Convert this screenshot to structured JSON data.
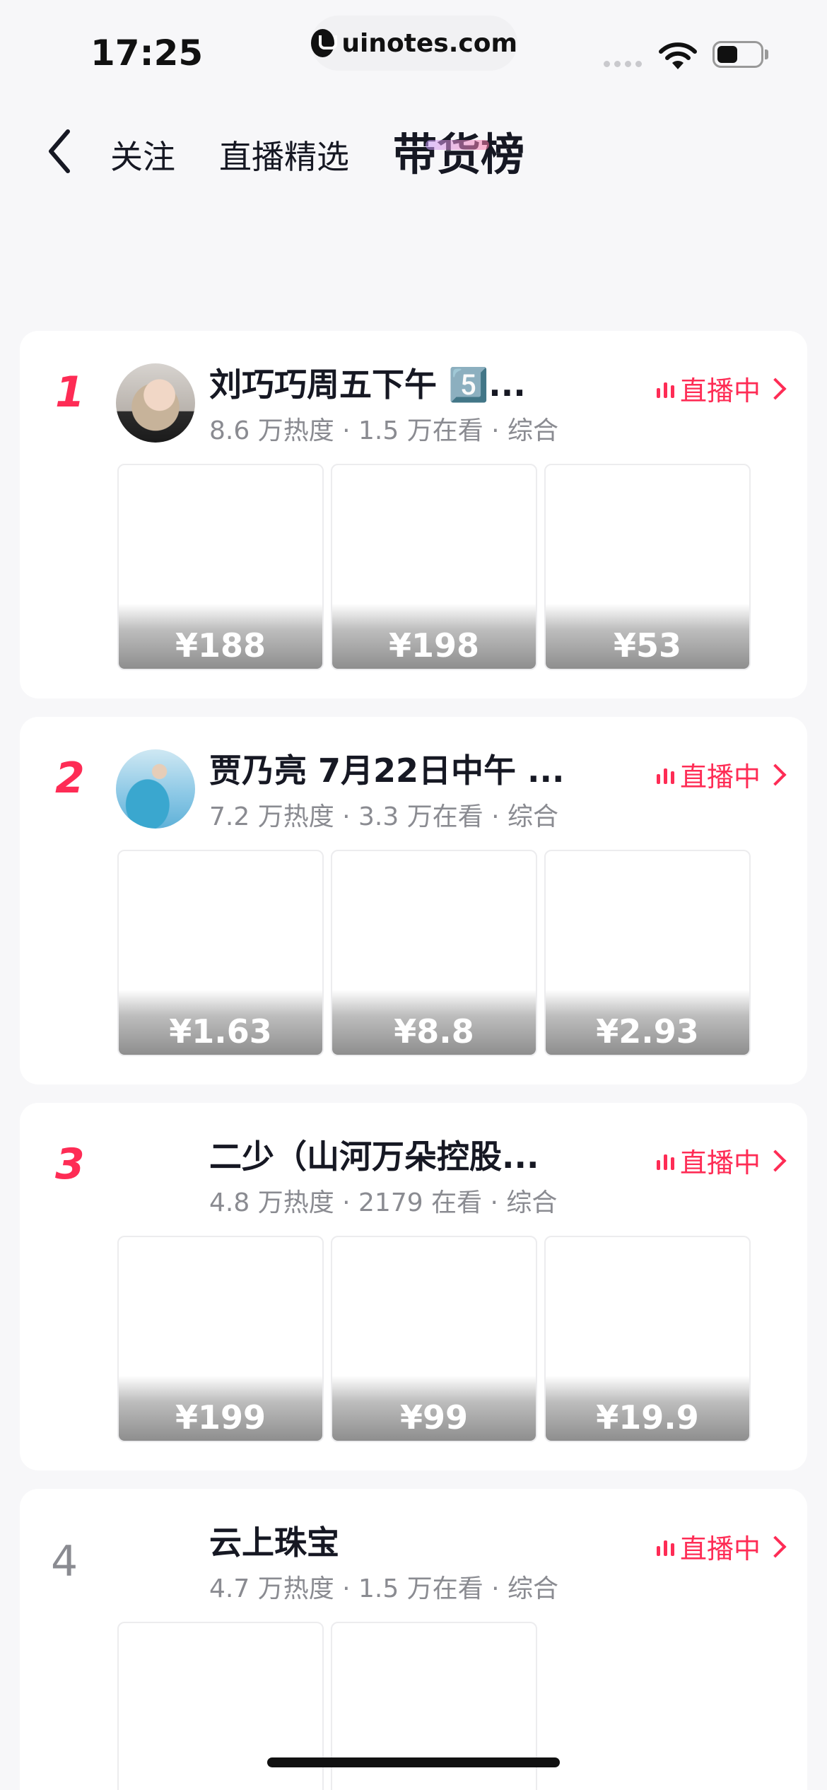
{
  "status_bar": {
    "time": "17:25",
    "url": "uinotes.com"
  },
  "nav": {
    "back_icon": "chevron-left-icon",
    "tabs": [
      {
        "label": "关注",
        "active": false
      },
      {
        "label": "直播精选",
        "active": false
      },
      {
        "label": "带货榜",
        "active": true
      }
    ]
  },
  "colors": {
    "accent": "#fe2c55",
    "text_primary": "#161823",
    "text_secondary": "#8a8b91",
    "background": "#f7f7f9"
  },
  "live_label": "直播中",
  "streamers": [
    {
      "rank": "1",
      "name": "刘巧巧周五下午 5️⃣...",
      "meta": "8.6 万热度 · 1.5 万在看 · 综合",
      "prices": [
        "¥188",
        "¥198",
        "¥53"
      ]
    },
    {
      "rank": "2",
      "name": "贾乃亮 7月22日中午 ...",
      "meta": "7.2 万热度 · 3.3 万在看 · 综合",
      "prices": [
        "¥1.63",
        "¥8.8",
        "¥2.93"
      ]
    },
    {
      "rank": "3",
      "name": "二少（山河万朵控股...",
      "meta": "4.8 万热度 · 2179 在看 · 综合",
      "prices": [
        "¥199",
        "¥99",
        "¥19.9"
      ]
    },
    {
      "rank": "4",
      "name": "云上珠宝",
      "meta": "4.7 万热度 · 1.5 万在看 · 综合",
      "prices": [
        "",
        ""
      ]
    }
  ]
}
